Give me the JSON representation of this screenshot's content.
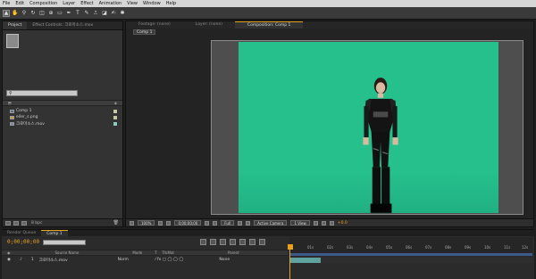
{
  "menu": [
    "File",
    "Edit",
    "Composition",
    "Layer",
    "Effect",
    "Animation",
    "View",
    "Window",
    "Help"
  ],
  "toolbar": {
    "tools": [
      "select-tool",
      "hand-tool",
      "zoom-tool",
      "rotate-tool",
      "camera-tool",
      "pan-behind-tool",
      "rectangle-mask-tool",
      "pen-tool",
      "text-tool",
      "brush-tool",
      "clone-stamp-tool",
      "eraser-tool",
      "roto-brush-tool",
      "puppet-tool"
    ]
  },
  "project_panel": {
    "tabs": [
      "Project",
      "Effect Controls: 크로마소스.mov"
    ],
    "items": [
      {
        "label": "Comp 1",
        "type": "comp",
        "swatch": "#c8c8a0"
      },
      {
        "label": "eiler_s.png",
        "type": "image",
        "swatch": "#c8c8a0"
      },
      {
        "label": "크로마소스.mov",
        "type": "video",
        "swatch": "#8ec8c0"
      }
    ],
    "footer_bpc": "8 bpc"
  },
  "comp_panel": {
    "tabs": [
      "Footage: (none)",
      "Layer: (none)",
      "Composition: Comp 1"
    ],
    "subtab": "Comp 1",
    "footer": {
      "zoom": "100%",
      "timecode": "0;00;00;00",
      "resolution": "Full",
      "camera": "Active Camera",
      "views": "1 View",
      "exposure": "+0.0"
    }
  },
  "timeline": {
    "tabs": [
      "Render Queue",
      "Comp 1"
    ],
    "timecode": "0;00;00;00",
    "columns": [
      "Source Name",
      "Mode",
      "T",
      "TrkMat",
      "Parent"
    ],
    "layer": {
      "index": "1",
      "name": "크로마소스.mov",
      "mode": "Norm",
      "parent": "None"
    },
    "ruler_labels": [
      "01s",
      "02s",
      "03s",
      "04s",
      "05s",
      "06s",
      "07s",
      "08s",
      "09s",
      "10s",
      "11s",
      "12s"
    ]
  }
}
